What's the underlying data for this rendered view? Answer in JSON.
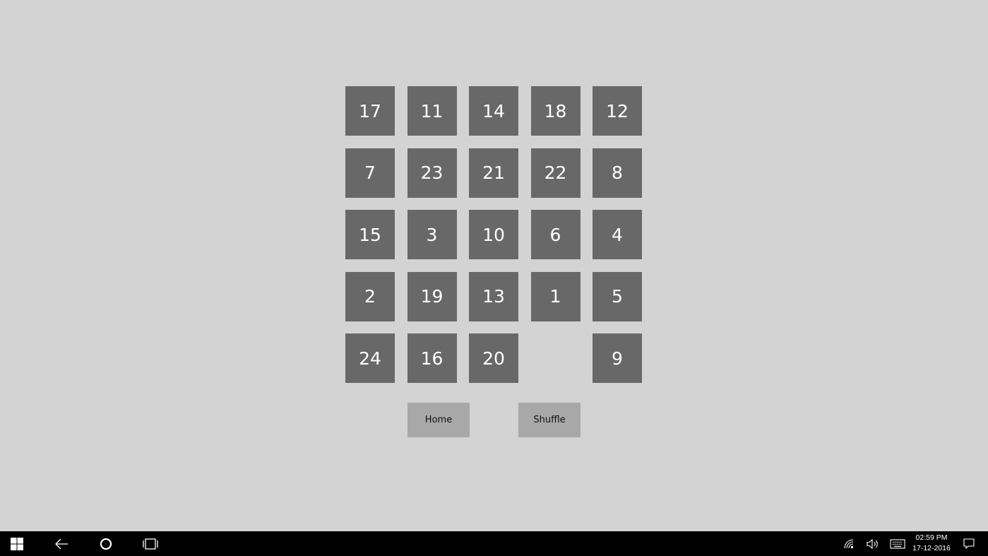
{
  "board": {
    "tiles": [
      "17",
      "11",
      "14",
      "18",
      "12",
      "7",
      "23",
      "21",
      "22",
      "8",
      "15",
      "3",
      "10",
      "6",
      "4",
      "2",
      "19",
      "13",
      "1",
      "5",
      "24",
      "16",
      "20",
      "",
      "9"
    ]
  },
  "controls": {
    "home_label": "Home",
    "shuffle_label": "Shuffle"
  },
  "taskbar": {
    "time": "02:59 PM",
    "date": "17-12-2016",
    "icons": [
      "windows-start-icon",
      "back-arrow-icon",
      "cortana-circle-icon",
      "task-view-icon",
      "network-icon",
      "volume-icon",
      "keyboard-icon",
      "notification-icon"
    ]
  },
  "colors": {
    "background": "#d3d3d3",
    "tile": "#686868",
    "tile_text": "#ffffff",
    "button": "#a8a8a8",
    "taskbar": "#000000"
  }
}
